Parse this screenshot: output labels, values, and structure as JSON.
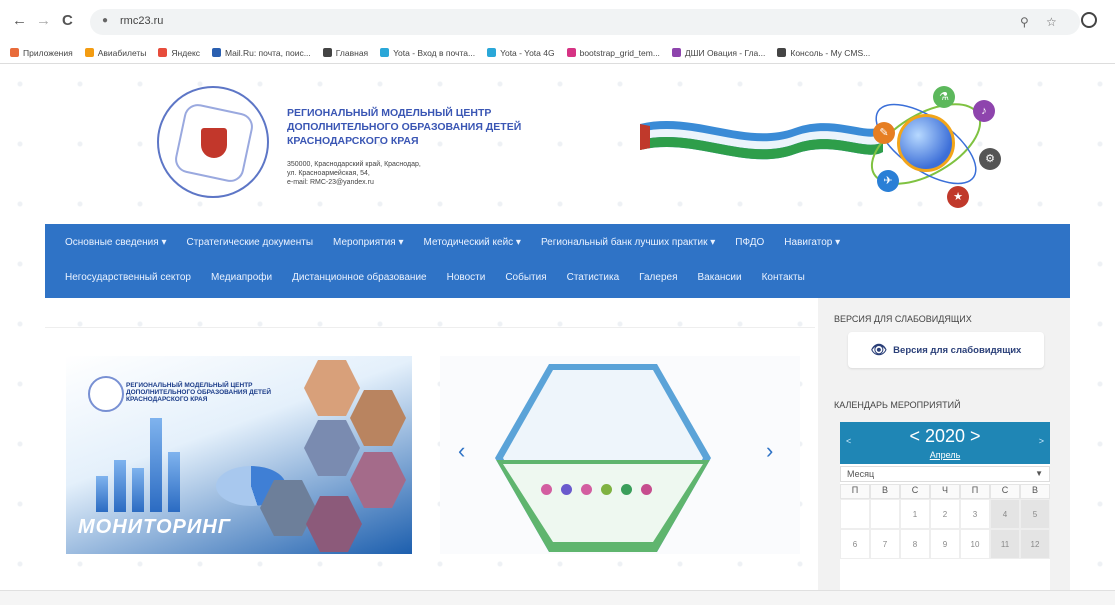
{
  "browser": {
    "back": "←",
    "forward": "→",
    "reload": "C",
    "url": "rmc23.ru",
    "zoom_icon": "search-icon",
    "star_icon": "star-icon"
  },
  "bookmarks": [
    {
      "label": "Приложения",
      "color": "#e86b3a"
    },
    {
      "label": "Авиабилеты",
      "color": "#f39c12"
    },
    {
      "label": "Яндекс",
      "color": "#e74c3c"
    },
    {
      "label": "Mail.Ru: почта, поис...",
      "color": "#2a5fb0"
    },
    {
      "label": "Главная",
      "color": "#444444"
    },
    {
      "label": "Yota - Вход в почта...",
      "color": "#2aa7d8"
    },
    {
      "label": "Yota - Yota 4G",
      "color": "#2aa7d8"
    },
    {
      "label": "bootstrap_grid_tem...",
      "color": "#d63384"
    },
    {
      "label": "ДШИ Овация - Гла...",
      "color": "#8e44ad"
    },
    {
      "label": "Консоль - My CMS...",
      "color": "#444444"
    }
  ],
  "header": {
    "org_title": "РЕГИОНАЛЬНЫЙ МОДЕЛЬНЫЙ ЦЕНТР ДОПОЛНИТЕЛЬНОГО ОБРАЗОВАНИЯ ДЕТЕЙ КРАСНОДАРСКОГО КРАЯ",
    "address_line1": "350000, Краснодарский край, Краснодар,",
    "address_line2": "ул. Красноармейская, 54,",
    "email": "e-mail: RMC-23@yandex.ru",
    "logo_ring_text": "РЕГИОНАЛЬНЫЙ МОДЕЛЬНЫЙ ЦЕНТР ДОПОЛНИТЕЛЬНОГО ОБРАЗОВАНИЯ ДЕТЕЙ"
  },
  "nav": {
    "row1": [
      "Основные сведения ▾",
      "Стратегические документы",
      "Мероприятия ▾",
      "Методический кейс ▾",
      "Региональный банк лучших практик ▾",
      "ПФДО",
      "Навигатор ▾"
    ],
    "row2": [
      "Негосударственный сектор",
      "Медиапрофи",
      "Дистанционное образование",
      "Новости",
      "События",
      "Статистика",
      "Галерея",
      "Вакансии",
      "Контакты"
    ]
  },
  "banner": {
    "title": "РЕГИОНАЛЬНЫЙ МОДЕЛЬНЫЙ ЦЕНТР ДОПОЛНИТЕЛЬНОГО ОБРАЗОВАНИЯ ДЕТЕЙ КРАСНОДАРСКОГО КРАЯ",
    "word": "МОНИТОРИНГ"
  },
  "carousel": {
    "prev": "‹",
    "next": "›"
  },
  "sidebar": {
    "vision_heading": "ВЕРСИЯ ДЛЯ СЛАБОВИДЯЩИХ",
    "vision_button": "Версия для слабовидящих",
    "calendar_heading": "КАЛЕНДАРЬ МЕРОПРИЯТИЙ"
  },
  "calendar": {
    "year": "< 2020 >",
    "month": "Апрель",
    "prev": "<",
    "next": ">",
    "select_value": "Месяц",
    "weekdays": [
      "П",
      "В",
      "С",
      "Ч",
      "П",
      "С",
      "В"
    ],
    "week1": [
      "",
      "",
      "1",
      "2",
      "3",
      "4",
      "5"
    ],
    "week2": [
      "6",
      "7",
      "8",
      "9",
      "10",
      "11",
      "12"
    ]
  }
}
